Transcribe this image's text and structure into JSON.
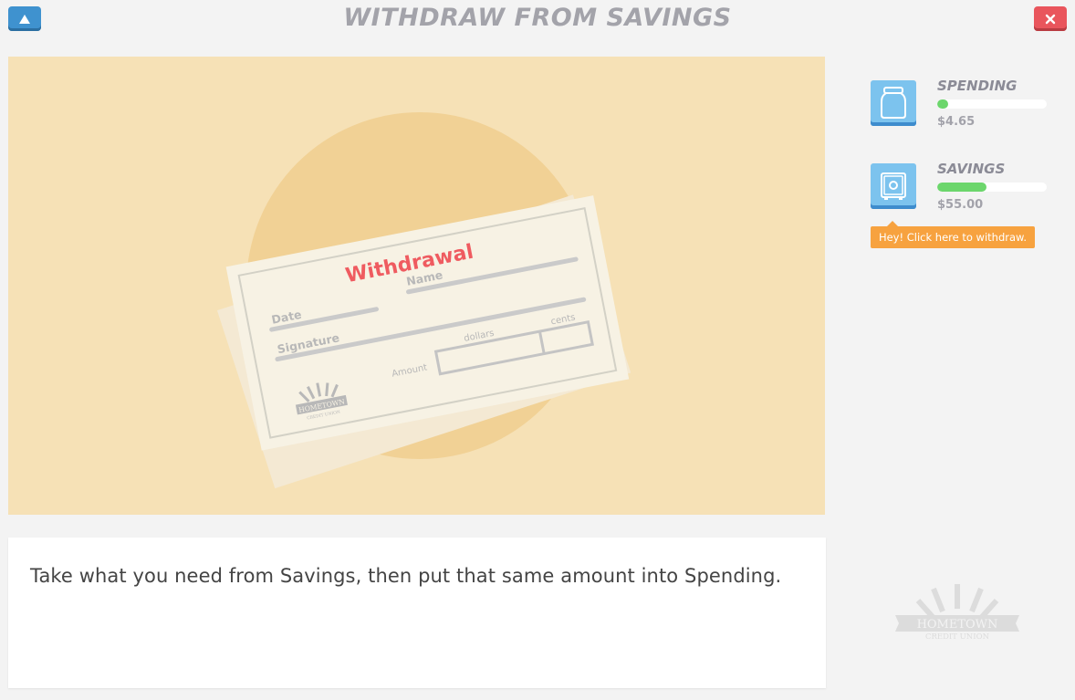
{
  "header": {
    "title": "WITHDRAW FROM SAVINGS",
    "up_icon": "triangle-up-icon",
    "close_icon": "close-x-icon"
  },
  "illustration": {
    "slip_title": "Withdrawal",
    "date_label": "Date",
    "name_label": "Name",
    "signature_label": "Signature",
    "dollars_label": "dollars",
    "cents_label": "cents",
    "amount_label": "Amount",
    "logo_text": "HOMETOWN",
    "logo_subtext": "CREDIT UNION"
  },
  "message": {
    "text": "Take what you need from Savings, then put that same amount into Spending."
  },
  "accounts": [
    {
      "name": "SPENDING",
      "amount": "$4.65",
      "icon": "jar-icon",
      "fill_fraction": 0.1,
      "fill_color": "#6cd66c"
    },
    {
      "name": "SAVINGS",
      "amount": "$55.00",
      "icon": "safe-icon",
      "fill_fraction": 0.45,
      "fill_color": "#6cd66c"
    }
  ],
  "tooltip": {
    "text": "Hey! Click here to withdraw."
  },
  "footer_logo": {
    "text": "HOMETOWN",
    "subtext": "CREDIT UNION"
  },
  "colors": {
    "background": "#f3f3f3",
    "illustration_bg": "#f6e1b6",
    "accent_blue": "#3f92cf",
    "accent_red": "#e9555c",
    "tooltip_orange": "#f7a23f",
    "progress_green": "#6cd66c"
  }
}
